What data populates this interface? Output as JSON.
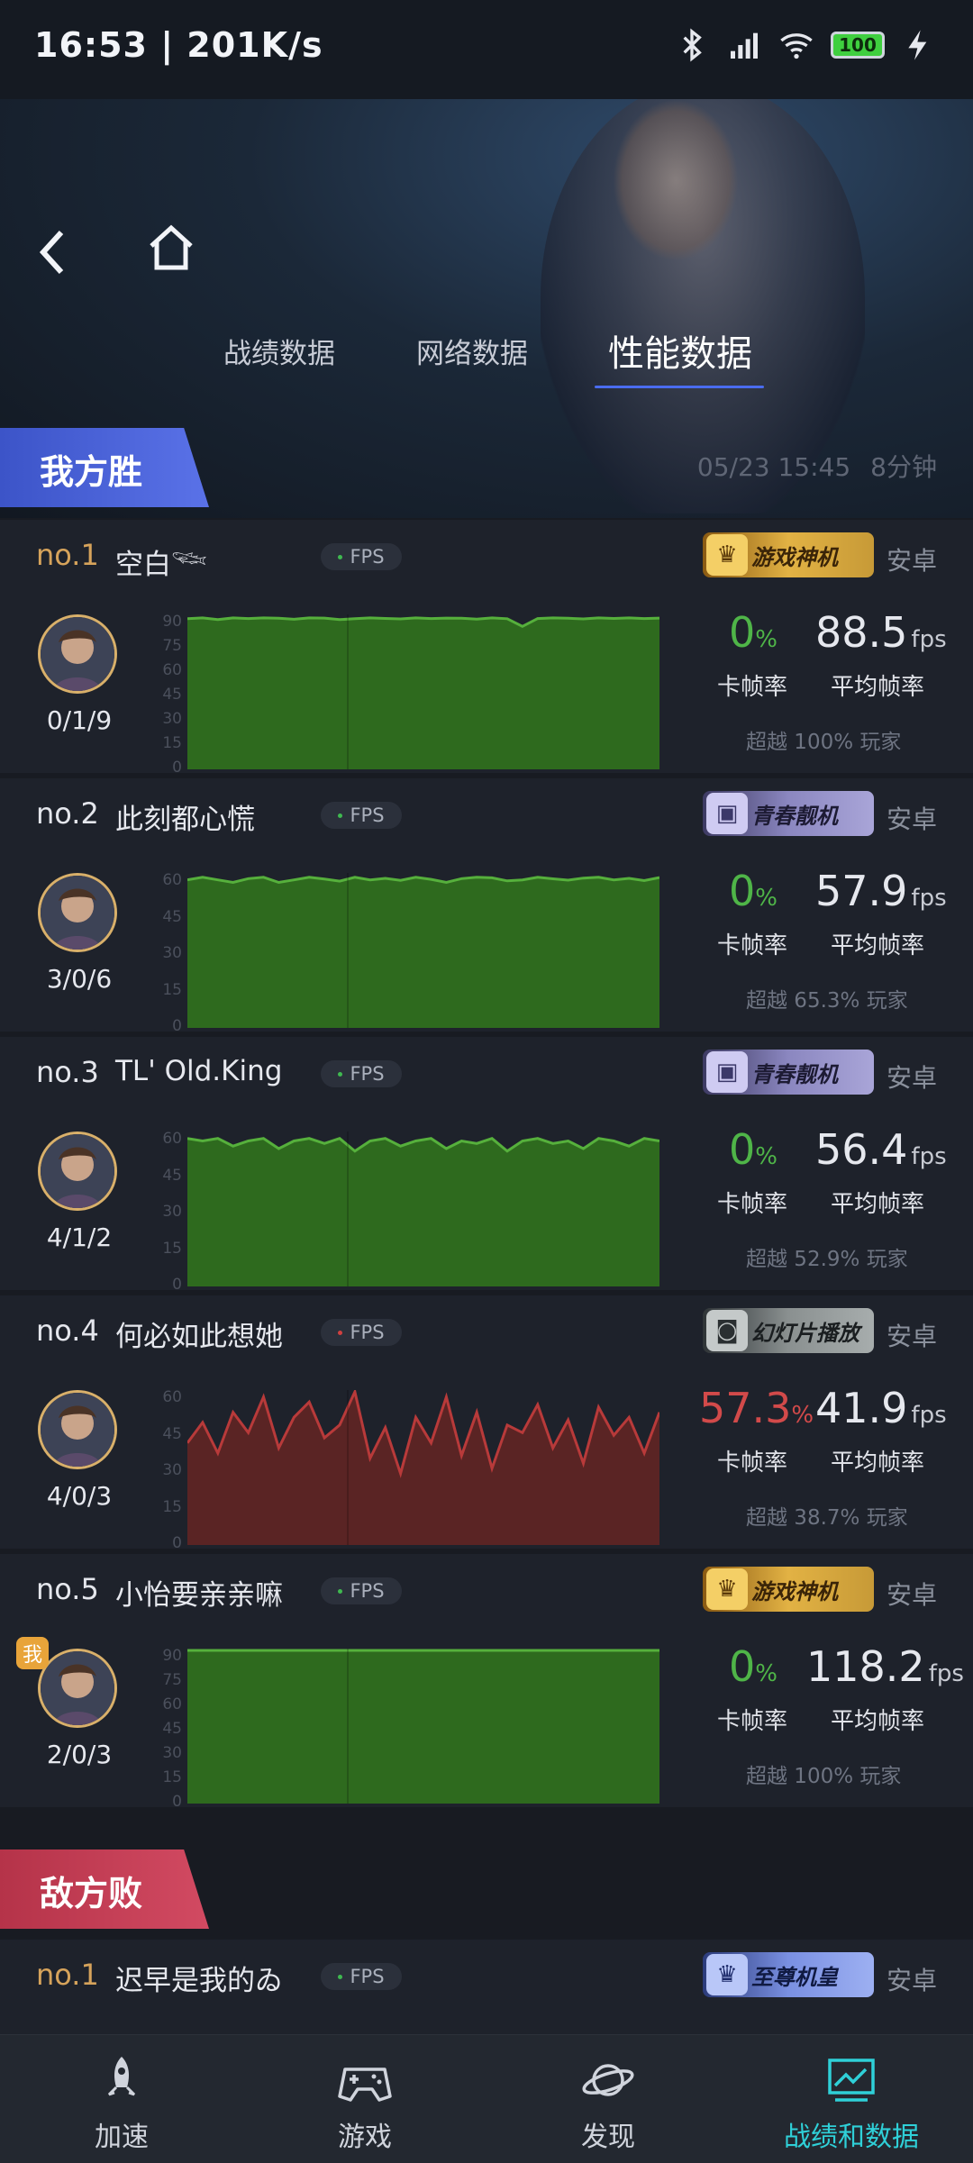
{
  "status_bar": {
    "time": "16:53 | 201K/s",
    "battery": "100"
  },
  "header": {
    "tabs": [
      {
        "label": "战绩数据",
        "active": false
      },
      {
        "label": "网络数据",
        "active": false
      },
      {
        "label": "性能数据",
        "active": true
      }
    ]
  },
  "match": {
    "date": "05/23 15:45",
    "duration": "8分钟"
  },
  "teams": {
    "win_label": "我方胜",
    "lose_label": "敌方败"
  },
  "chart_label": "FPS",
  "stat_labels": {
    "stutter": "卡帧率",
    "avg": "平均帧率"
  },
  "players": [
    {
      "rank": "no.1",
      "name": "空白𓆝",
      "badge": "游戏神机",
      "badge_color": "gold",
      "platform": "安卓",
      "kda": "0/1/9",
      "stutter_value": "0",
      "stutter_unit": "%",
      "avg_value": "88.5",
      "avg_unit": "fps",
      "beat": "超越 100% 玩家",
      "y_ticks": [
        "90",
        "75",
        "60",
        "45",
        "30",
        "15",
        "0"
      ],
      "y_max": 90,
      "fill": "#2e6a1e",
      "line": "#56b03c",
      "me": false,
      "series": [
        88.5,
        89,
        88,
        89,
        88.6,
        89,
        88.8,
        88.2,
        89,
        88.9,
        88,
        88.5,
        89,
        88.7,
        88.4,
        89,
        88.6,
        88.9,
        88.8,
        88.3,
        89,
        88.5,
        84,
        88.6,
        89,
        88.8,
        88.4,
        89,
        88.7,
        89,
        88.6,
        88.9
      ]
    },
    {
      "rank": "no.2",
      "name": "此刻都心慌",
      "badge": "青春靓机",
      "badge_color": "purple",
      "platform": "安卓",
      "kda": "3/0/6",
      "stutter_value": "0",
      "stutter_unit": "%",
      "avg_value": "57.9",
      "avg_unit": "fps",
      "beat": "超越 65.3% 玩家",
      "y_ticks": [
        "60",
        "45",
        "30",
        "15",
        "0"
      ],
      "y_max": 60,
      "fill": "#2e6a1e",
      "line": "#56b03c",
      "me": false,
      "series": [
        58,
        59,
        58,
        57,
        58.5,
        59,
        57,
        58,
        59,
        58.3,
        57.5,
        59,
        58,
        58.6,
        57.8,
        59,
        58.2,
        57,
        58.5,
        59,
        58.8,
        57.6,
        58,
        59,
        58.4,
        57.9,
        58.7,
        59,
        58,
        58.6,
        57.7,
        58.9
      ]
    },
    {
      "rank": "no.3",
      "name": "TL' Old.King",
      "badge": "青春靓机",
      "badge_color": "purple",
      "platform": "安卓",
      "kda": "4/1/2",
      "stutter_value": "0",
      "stutter_unit": "%",
      "avg_value": "56.4",
      "avg_unit": "fps",
      "beat": "超越 52.9% 玩家",
      "y_ticks": [
        "60",
        "45",
        "30",
        "15",
        "0"
      ],
      "y_max": 60,
      "fill": "#2e6a1e",
      "line": "#56b03c",
      "me": false,
      "series": [
        58,
        57,
        58,
        55,
        57,
        58,
        54,
        57,
        58,
        56,
        58,
        53,
        57,
        58,
        55,
        57,
        58,
        54,
        57,
        56,
        58,
        53,
        57,
        58,
        56,
        57,
        54,
        58,
        57,
        55,
        58,
        57
      ]
    },
    {
      "rank": "no.4",
      "name": "何必如此想她",
      "badge": "幻灯片播放",
      "badge_color": "gray",
      "platform": "安卓",
      "kda": "4/0/3",
      "stutter_value": "57.3",
      "stutter_unit": "%",
      "avg_value": "41.9",
      "avg_unit": "fps",
      "beat": "超越 38.7% 玩家",
      "y_ticks": [
        "60",
        "45",
        "30",
        "15",
        "0"
      ],
      "y_max": 60,
      "fill": "#5a2424",
      "line": "#b83a3a",
      "me": false,
      "red": true,
      "series": [
        40,
        48,
        36,
        52,
        44,
        58,
        38,
        50,
        56,
        42,
        47,
        60,
        34,
        46,
        28,
        50,
        40,
        58,
        35,
        52,
        30,
        47,
        44,
        55,
        38,
        49,
        32,
        54,
        43,
        50,
        36,
        52
      ]
    },
    {
      "rank": "no.5",
      "name": "小怡要亲亲嘛",
      "badge": "游戏神机",
      "badge_color": "gold",
      "platform": "安卓",
      "kda": "2/0/3",
      "stutter_value": "0",
      "stutter_unit": "%",
      "avg_value": "118.2",
      "avg_unit": "fps",
      "beat": "超越 100% 玩家",
      "y_ticks": [
        "90",
        "75",
        "60",
        "45",
        "30",
        "15",
        "0"
      ],
      "y_max": 90,
      "fill": "#2e6a1e",
      "line": "#56b03c",
      "me": true,
      "me_tag": "我",
      "series": [
        90,
        90,
        90,
        90,
        90,
        90,
        90,
        90,
        90,
        90,
        90,
        90,
        90,
        90,
        90,
        90,
        90,
        90,
        90,
        90,
        90,
        90,
        90,
        90,
        90,
        90,
        90,
        90,
        90,
        90,
        90,
        90
      ]
    }
  ],
  "enemy_first": {
    "rank": "no.1",
    "name": "迟早是我的ゐ",
    "badge": "至尊机皇",
    "badge_color": "blue",
    "platform": "安卓"
  },
  "bottom_nav": [
    {
      "label": "加速",
      "icon": "rocket-icon",
      "active": false
    },
    {
      "label": "游戏",
      "icon": "gamepad-icon",
      "active": false
    },
    {
      "label": "发现",
      "icon": "planet-icon",
      "active": false
    },
    {
      "label": "战绩和数据",
      "icon": "chart-icon",
      "active": true
    }
  ]
}
